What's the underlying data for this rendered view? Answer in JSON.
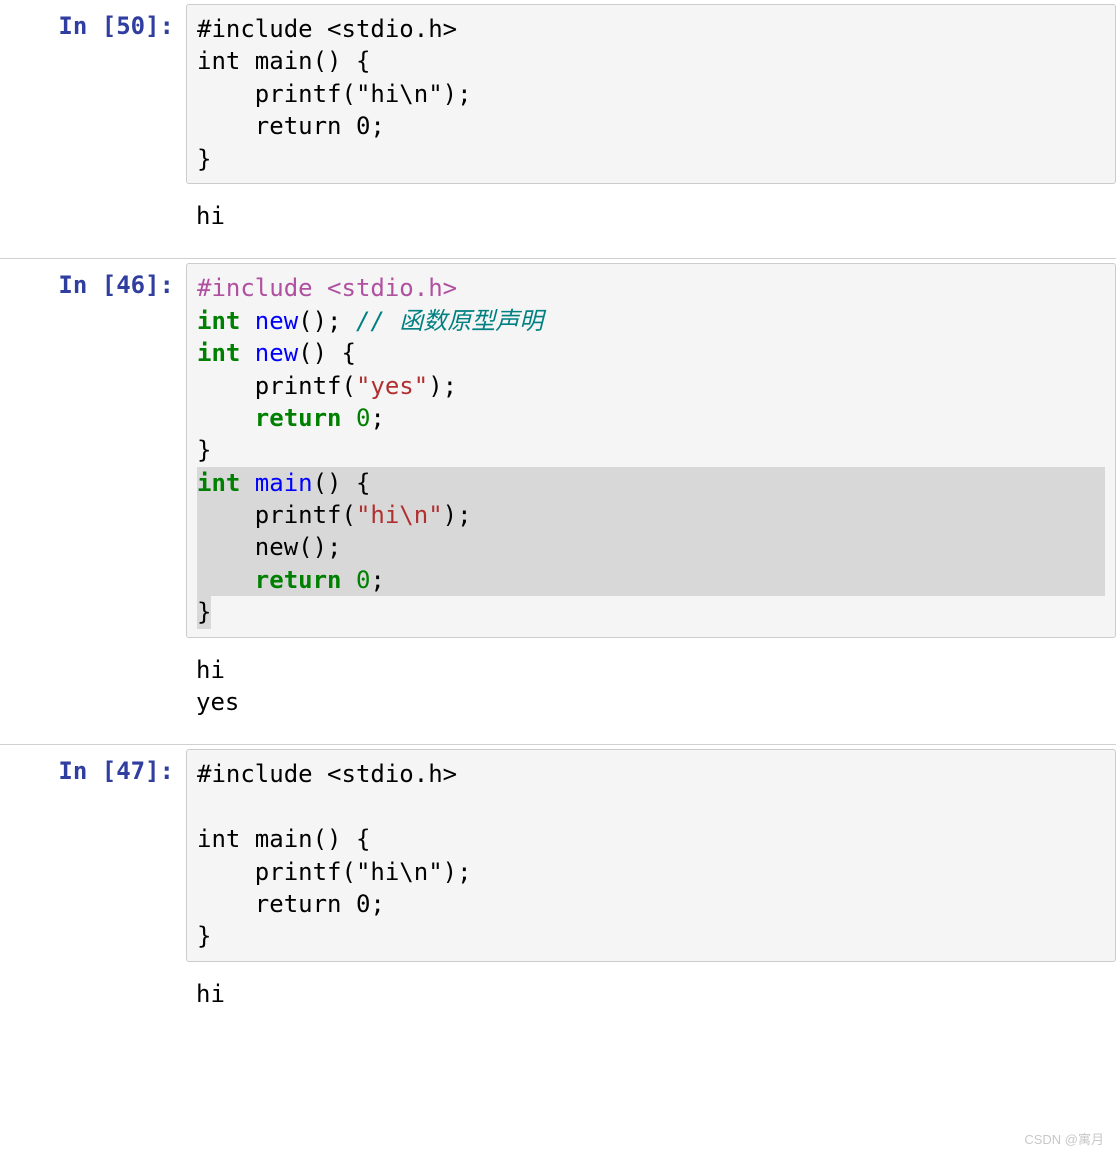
{
  "cells": {
    "c1": {
      "prompt": "In [50]:",
      "code": {
        "l1": "#include <stdio.h>",
        "l2_kw": "int",
        "l2_fn": " main",
        "l2_rest": "() {",
        "l3_pre": "    printf(",
        "l3_str": "\"hi\\n\"",
        "l3_post": ");",
        "l4_pre": "    ",
        "l4_kw": "return",
        "l4_post": " ",
        "l4_num": "0",
        "l4_end": ";",
        "l5": "}"
      },
      "output": "hi"
    },
    "c2": {
      "prompt": "In [46]:",
      "code": {
        "l1_pp": "#include",
        "l1_rest": " ",
        "l1_file": "<stdio.h>",
        "blank1": "",
        "l3_kw": "int",
        "l3_fn": " new",
        "l3_rest": "(); ",
        "l3_cm": "// 函数原型声明",
        "l4_kw": "int",
        "l4_fn": " new",
        "l4_rest": "() {",
        "l5_pre": "    printf(",
        "l5_str": "\"yes\"",
        "l5_post": ");",
        "l6_pre": "    ",
        "l6_kw": "return",
        "l6_sp": " ",
        "l6_num": "0",
        "l6_end": ";",
        "l7": "}",
        "l8_kw": "int",
        "l8_fn": " main",
        "l8_rest": "() {",
        "l9_pre": "    printf(",
        "l9_str": "\"hi\\n\"",
        "l9_post": ");",
        "l10": "    new();",
        "l11_pre": "    ",
        "l11_kw": "return",
        "l11_sp": " ",
        "l11_num": "0",
        "l11_end": ";",
        "l12": "}"
      },
      "output": "hi\nyes"
    },
    "c3": {
      "prompt": "In [47]:",
      "code": {
        "l1": "#include <stdio.h>",
        "blank1": "",
        "l2_kw": "int",
        "l2_fn": " main",
        "l2_rest": "() {",
        "l3_pre": "    printf(",
        "l3_str": "\"hi\\n\"",
        "l3_post": ");",
        "l4_pre": "    ",
        "l4_kw": "return",
        "l4_sp": " ",
        "l4_num": "0",
        "l4_end": ";",
        "l5": "}"
      },
      "output": "hi"
    }
  },
  "watermark": "CSDN @寓月"
}
